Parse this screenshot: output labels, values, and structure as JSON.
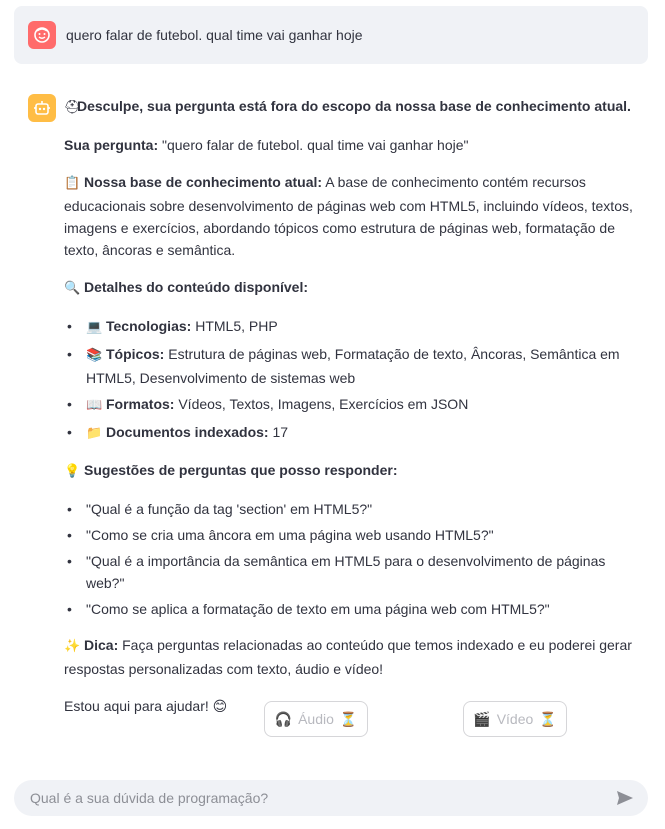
{
  "user_message": {
    "avatar_icon": "smiley-face-icon",
    "avatar_color": "#ff6b6b",
    "text": "quero falar de futebol. qual time vai ganhar hoje"
  },
  "bot_message": {
    "avatar_icon": "robot-icon",
    "avatar_color": "#ffbd45",
    "heading_emoji": "⛑",
    "heading": "Desculpe, sua pergunta está fora do escopo da nossa base de conhecimento atual.",
    "question_label": "Sua pergunta:",
    "question_text": " \"quero falar de futebol. qual time vai ganhar hoje\"",
    "kb_emoji": "📋",
    "kb_label": "Nossa base de conhecimento atual:",
    "kb_text": " A base de conhecimento contém recursos educacionais sobre desenvolvimento de páginas web com HTML5, incluindo vídeos, textos, imagens e exercícios, abordando tópicos como estrutura de páginas web, formatação de texto, âncoras e semântica.",
    "details_emoji": "🔍",
    "details_label": "Detalhes do conteúdo disponível:",
    "details": [
      {
        "emoji": "💻",
        "label": "Tecnologias:",
        "text": " HTML5, PHP"
      },
      {
        "emoji": "📚",
        "label": "Tópicos:",
        "text": " Estrutura de páginas web, Formatação de texto, Âncoras, Semântica em HTML5, Desenvolvimento de sistemas web"
      },
      {
        "emoji": "📖",
        "label": "Formatos:",
        "text": " Vídeos, Textos, Imagens, Exercícios em JSON"
      },
      {
        "emoji": "📁",
        "label": "Documentos indexados:",
        "text": " 17"
      }
    ],
    "suggest_emoji": "💡",
    "suggest_label": "Sugestões de perguntas que posso responder:",
    "suggestions": [
      "\"Qual é a função da tag 'section' em HTML5?\"",
      "\"Como se cria uma âncora em uma página web usando HTML5?\"",
      "\"Qual é a importância da semântica em HTML5 para o desenvolvimento de páginas web?\"",
      "\"Como se aplica a formatação de texto em uma página web com HTML5?\""
    ],
    "tip_emoji": "✨",
    "tip_label": "Dica:",
    "tip_text": " Faça perguntas relacionadas ao conteúdo que temos indexado e eu poderei gerar respostas personalizadas com texto, áudio e vídeo!",
    "closing": "Estou aqui para ajudar! 😊"
  },
  "media_buttons": {
    "audio_icon": "🎧",
    "audio_label": "Áudio",
    "audio_status": "⏳",
    "video_icon": "🎬",
    "video_label": "Vídeo",
    "video_status": "⏳"
  },
  "chat_input": {
    "placeholder": "Qual é a sua dúvida de programação?",
    "send_icon": "send-icon"
  }
}
